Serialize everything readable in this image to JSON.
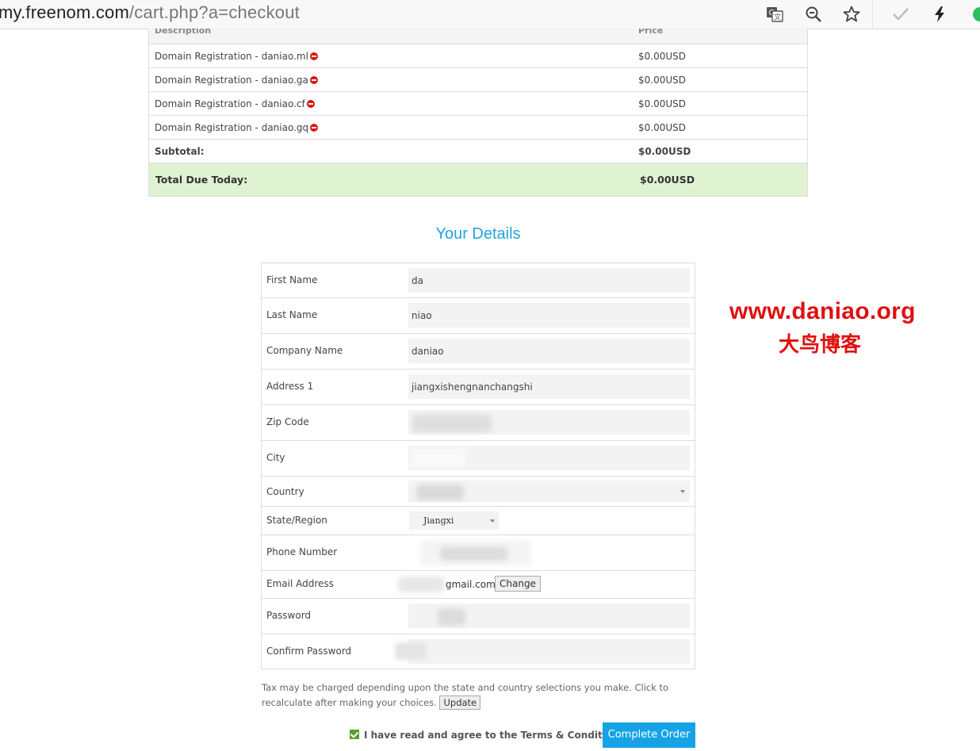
{
  "browser": {
    "url_host": "my.freenom.com",
    "url_path": "/cart.php?a=checkout",
    "icons": [
      "translate-icon",
      "zoom-out-icon",
      "star-icon",
      "check-icon",
      "lightning-icon",
      "evernote-icon"
    ]
  },
  "cart": {
    "header": {
      "description": "Description",
      "price": "Price"
    },
    "items": [
      {
        "description": "Domain Registration - daniao.ml",
        "price": "$0.00USD"
      },
      {
        "description": "Domain Registration - daniao.ga",
        "price": "$0.00USD"
      },
      {
        "description": "Domain Registration - daniao.cf",
        "price": "$0.00USD"
      },
      {
        "description": "Domain Registration - daniao.gq",
        "price": "$0.00USD"
      }
    ],
    "subtotal_label": "Subtotal:",
    "subtotal_value": "$0.00USD",
    "total_label": "Total Due Today:",
    "total_value": "$0.00USD",
    "total_bg": "#dff2d2"
  },
  "details": {
    "title": "Your Details",
    "fields": {
      "first_name": {
        "label": "First Name",
        "value": "da"
      },
      "last_name": {
        "label": "Last Name",
        "value": "niao"
      },
      "company": {
        "label": "Company Name",
        "value": "daniao"
      },
      "address1": {
        "label": "Address 1",
        "value": "jiangxishengnanchangshi"
      },
      "zip": {
        "label": "Zip Code",
        "value": ""
      },
      "city": {
        "label": "City",
        "value": ""
      },
      "country": {
        "label": "Country",
        "value": ""
      },
      "state": {
        "label": "State/Region",
        "value": "Jiangxi"
      },
      "phone": {
        "label": "Phone Number",
        "value": ""
      },
      "email": {
        "label": "Email Address",
        "value": "gmail.com"
      },
      "password": {
        "label": "Password",
        "value": ""
      },
      "confirm_password": {
        "label": "Confirm Password",
        "value": ""
      }
    },
    "change_button": "Change"
  },
  "tax_note": "Tax may be charged depending upon the state and country selections you make. Click to recalculate after making your choices.",
  "update_button": "Update",
  "agree_text": "I have read and agree to the Terms & Conditions",
  "agree_checked": true,
  "complete_button": "Complete Order",
  "accent": "#15a3e6",
  "watermark": {
    "line1": "www.daniao.org",
    "line2": "大鸟博客"
  }
}
